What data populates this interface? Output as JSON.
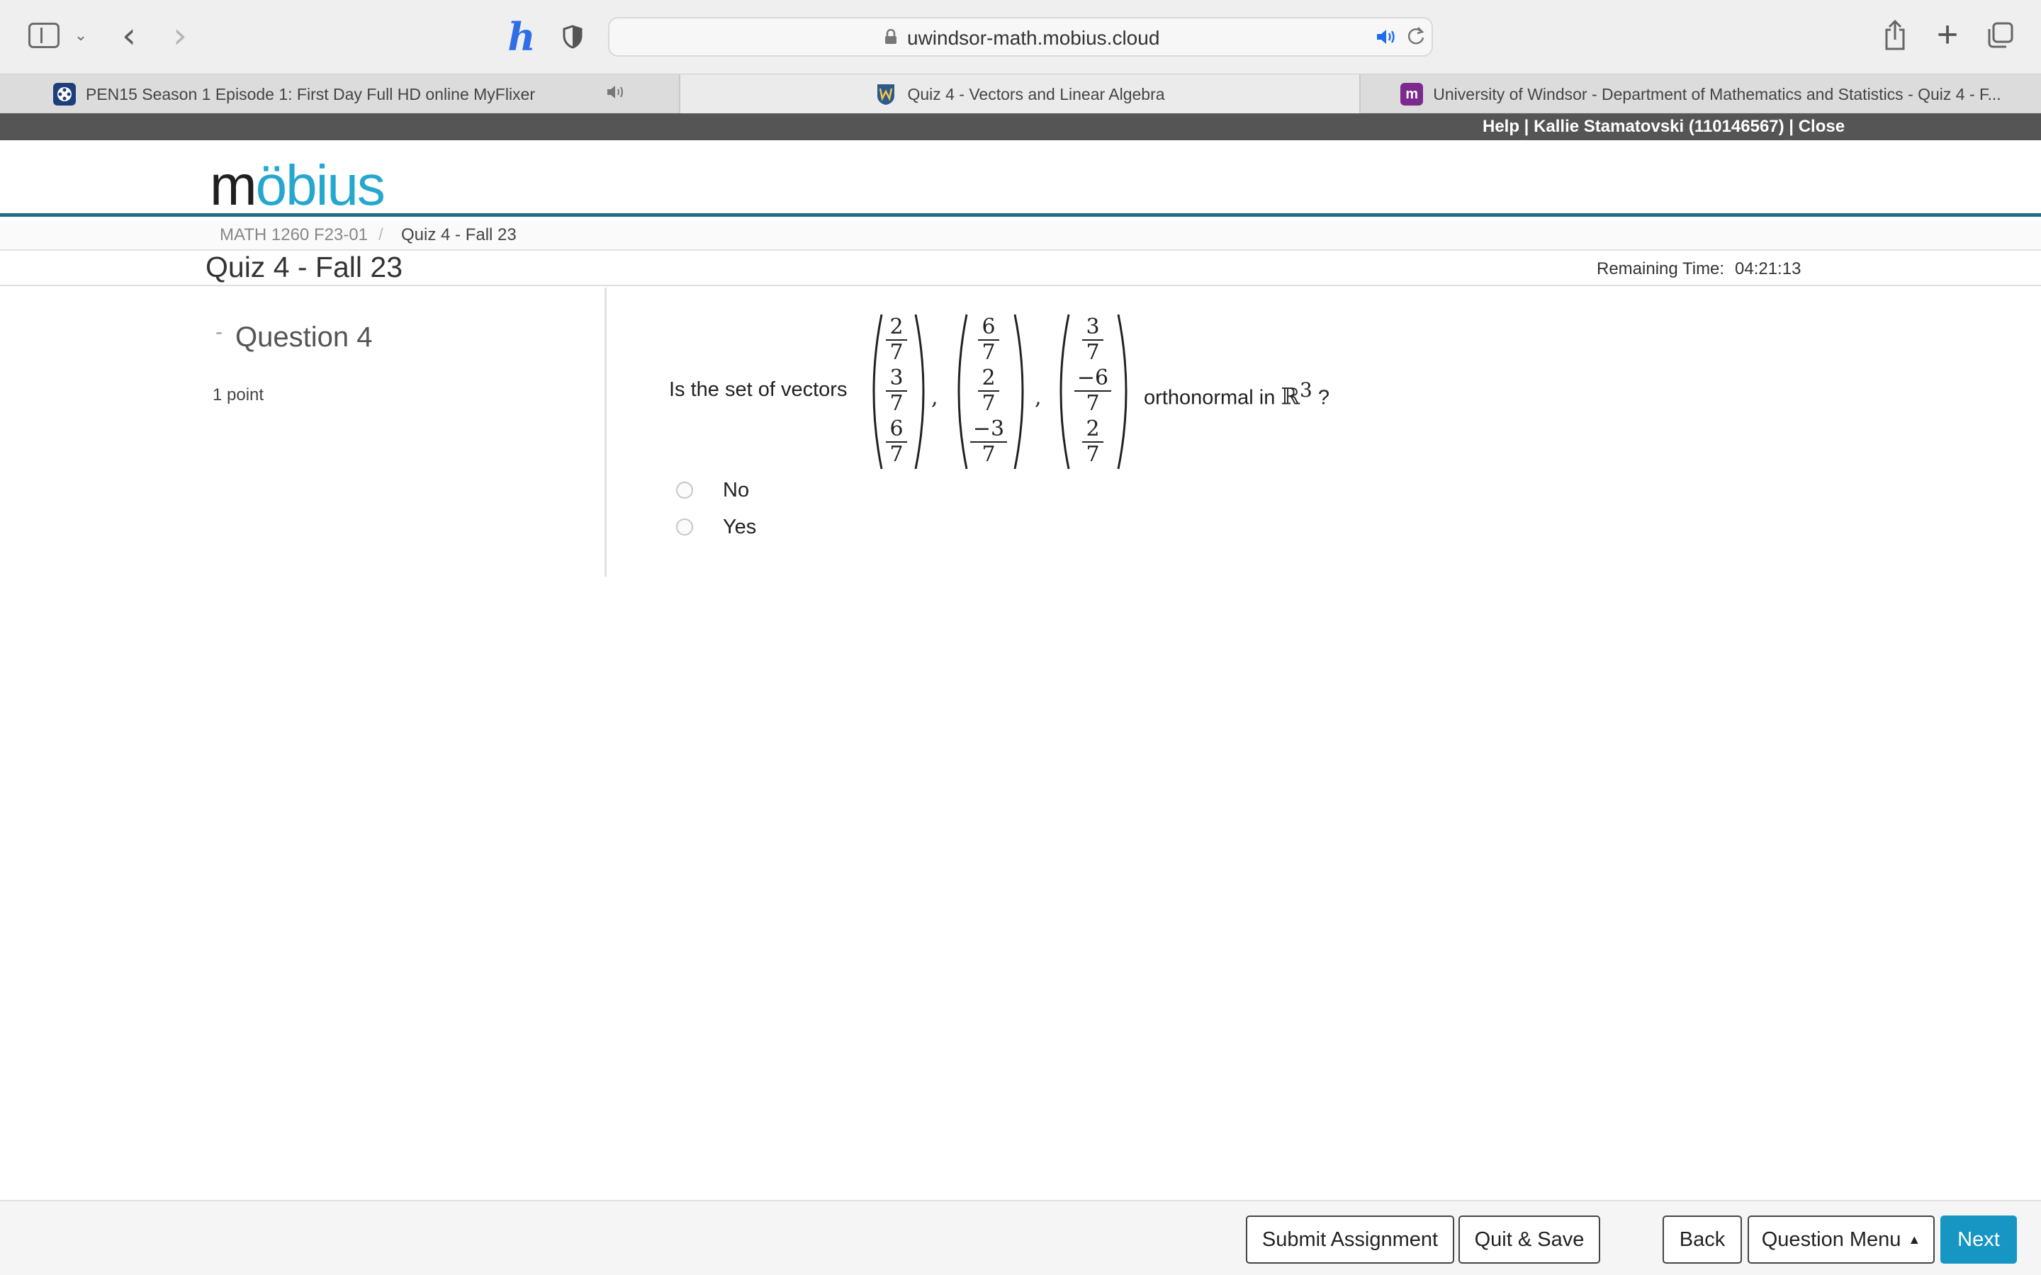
{
  "browser": {
    "url": "uwindsor-math.mobius.cloud",
    "tabs": [
      {
        "label": "PEN15 Season 1 Episode 1: First Day Full HD online MyFlixer",
        "favicon": "film-reel-icon",
        "audio": true
      },
      {
        "label": "Quiz 4 - Vectors and Linear Algebra",
        "favicon": "uwindsor-shield-icon",
        "active": true
      },
      {
        "label": "University of Windsor - Department of Mathematics and Statistics - Quiz 4 - F...",
        "favicon": "mobius-m-icon",
        "favicon_letter": "m"
      }
    ]
  },
  "userbar": {
    "help": "Help",
    "sep1": " | ",
    "user": "Kallie Stamatovski (110146567)",
    "sep2": " | ",
    "close": "Close"
  },
  "logo": {
    "part1": "m",
    "part2": "ö",
    "part3": "b",
    "part4": "ius"
  },
  "breadcrumb": {
    "course": "MATH 1260 F23-01",
    "separator": "/",
    "current": "Quiz 4 - Fall 23"
  },
  "header": {
    "title": "Quiz 4 - Fall 23",
    "remaining_label": "Remaining Time:",
    "remaining_value": "04:21:13"
  },
  "question": {
    "collapse_symbol": "-",
    "title": "Question 4",
    "points": "1 point",
    "text_before": "Is the set of vectors",
    "text_after": "orthonormal in",
    "space_symbol": "ℝ",
    "space_exponent": "3",
    "question_mark": "?",
    "vectors": [
      [
        {
          "num": "2",
          "den": "7"
        },
        {
          "num": "3",
          "den": "7"
        },
        {
          "num": "6",
          "den": "7"
        }
      ],
      [
        {
          "num": "6",
          "den": "7"
        },
        {
          "num": "2",
          "den": "7"
        },
        {
          "num": "−3",
          "den": "7"
        }
      ],
      [
        {
          "num": "3",
          "den": "7"
        },
        {
          "num": "−6",
          "den": "7"
        },
        {
          "num": "2",
          "den": "7"
        }
      ]
    ],
    "comma": ",",
    "options": [
      {
        "label": "No",
        "selected": false
      },
      {
        "label": "Yes",
        "selected": false
      }
    ]
  },
  "footer": {
    "submit": "Submit Assignment",
    "quit_save": "Quit & Save",
    "back": "Back",
    "question_menu": "Question Menu",
    "menu_caret": "▲",
    "next": "Next"
  },
  "colors": {
    "accent": "#1796c4",
    "userbar": "#555555",
    "logo_blue": "#25a7cf",
    "rule": "#1b6e8c"
  }
}
